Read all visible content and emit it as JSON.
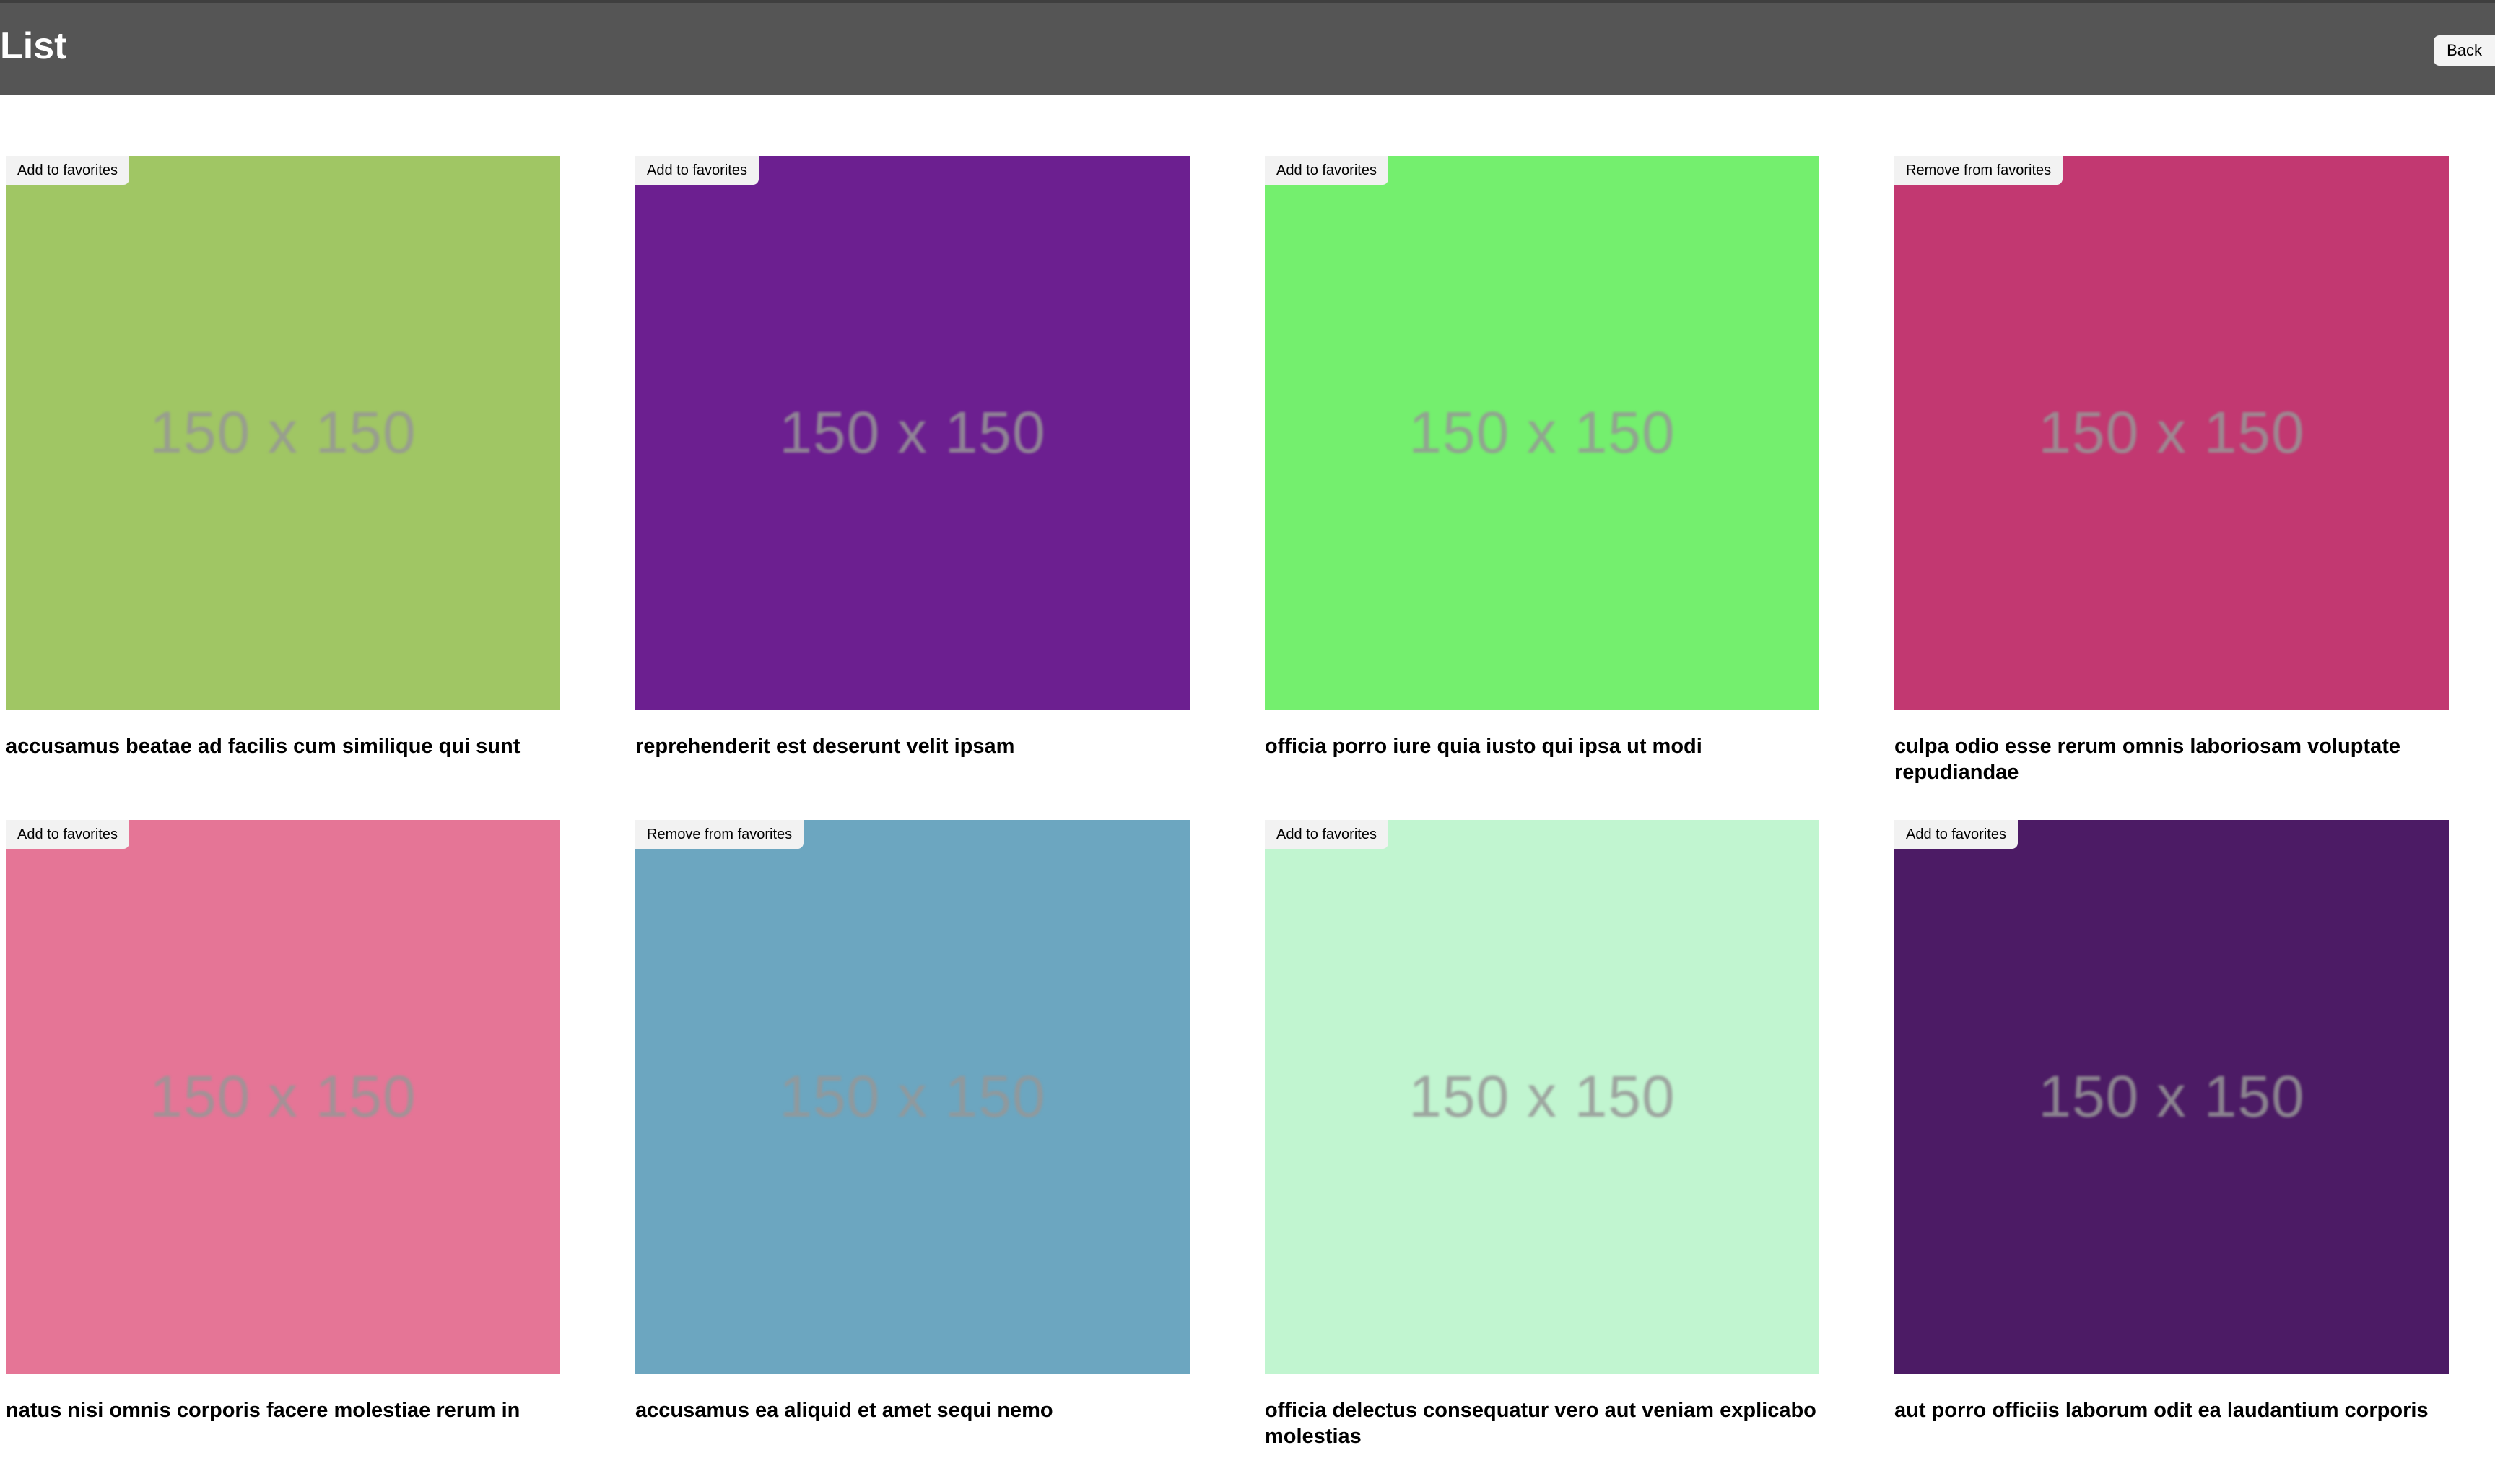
{
  "header": {
    "title": "List",
    "back_label": "Back"
  },
  "items": [
    {
      "color": "#a0c664",
      "image_text": "150 x 150",
      "fav_label": "Add to favorites",
      "title": "accusamus beatae ad facilis cum similique qui sunt"
    },
    {
      "color": "#6c1f90",
      "image_text": "150 x 150",
      "fav_label": "Add to favorites",
      "title": "reprehenderit est deserunt velit ipsam"
    },
    {
      "color": "#74ef6e",
      "image_text": "150 x 150",
      "fav_label": "Add to favorites",
      "title": "officia porro iure quia iusto qui ipsa ut modi"
    },
    {
      "color": "#c23871",
      "image_text": "150 x 150",
      "fav_label": "Remove from favorites",
      "title": "culpa odio esse rerum omnis laboriosam voluptate repudiandae"
    },
    {
      "color": "#e57596",
      "image_text": "150 x 150",
      "fav_label": "Add to favorites",
      "title": "natus nisi omnis corporis facere molestiae rerum in"
    },
    {
      "color": "#6ca6c0",
      "image_text": "150 x 150",
      "fav_label": "Remove from favorites",
      "title": "accusamus ea aliquid et amet sequi nemo"
    },
    {
      "color": "#c1f5d0",
      "image_text": "150 x 150",
      "fav_label": "Add to favorites",
      "title": "officia delectus consequatur vero aut veniam explicabo molestias"
    },
    {
      "color": "#4c1b65",
      "image_text": "150 x 150",
      "fav_label": "Add to favorites",
      "title": "aut porro officiis laborum odit ea laudantium corporis"
    }
  ]
}
